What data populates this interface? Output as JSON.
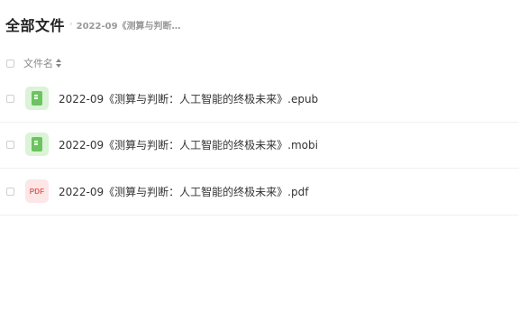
{
  "breadcrumb": {
    "root": "全部文件",
    "separator": "›",
    "current": "2022-09《测算与判断…"
  },
  "header": {
    "name_column": "文件名"
  },
  "files": [
    {
      "name": "2022-09《测算与判断：人工智能的终极未来》.epub",
      "icon": "book-icon"
    },
    {
      "name": "2022-09《测算与判断：人工智能的终极未来》.mobi",
      "icon": "book-icon"
    },
    {
      "name": "2022-09《测算与判断：人工智能的终极未来》.pdf",
      "icon": "pdf-icon",
      "icon_text": "PDF"
    }
  ],
  "colors": {
    "book_icon_bg": "#dbf3d7",
    "book_icon_fg": "#6cc35f",
    "pdf_icon_bg": "#fde6e6",
    "pdf_icon_fg": "#e55b5b"
  }
}
